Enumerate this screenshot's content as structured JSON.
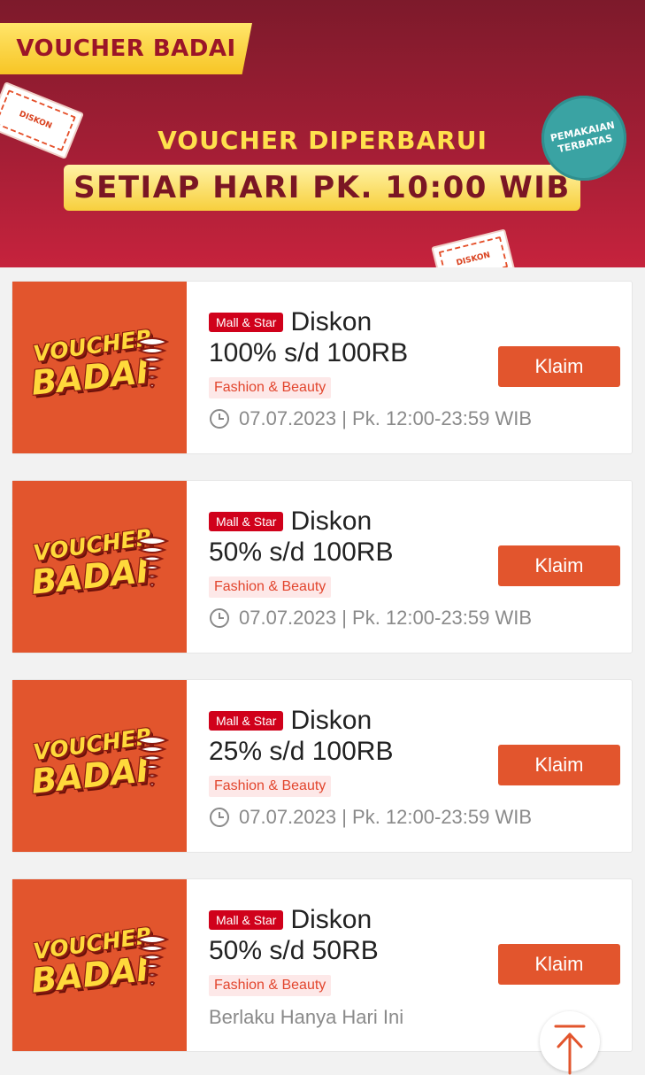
{
  "banner": {
    "tag": "VOUCHER BADAI",
    "headline_1": "VOUCHER DIPERBARUI",
    "headline_2": "SETIAP HARI PK. 10:00 WIB",
    "limit_badge_line1": "PEMAKAIAN",
    "limit_badge_line2": "TERBATAS",
    "deco_ticket_text": "DISKON"
  },
  "logo": {
    "line1": "VOUCHER",
    "line2": "BADAI"
  },
  "vouchers": [
    {
      "badge": "Mall & Star",
      "title": "Diskon",
      "amount": "100% s/d 100RB",
      "category": "Fashion & Beauty",
      "time": "07.07.2023 | Pk. 12:00-23:59 WIB",
      "claim": "Klaim"
    },
    {
      "badge": "Mall & Star",
      "title": "Diskon",
      "amount": "50% s/d 100RB",
      "category": "Fashion & Beauty",
      "time": "07.07.2023 | Pk. 12:00-23:59 WIB",
      "claim": "Klaim"
    },
    {
      "badge": "Mall & Star",
      "title": "Diskon",
      "amount": "25% s/d 100RB",
      "category": "Fashion & Beauty",
      "time": "07.07.2023 | Pk. 12:00-23:59 WIB",
      "claim": "Klaim"
    },
    {
      "badge": "Mall & Star",
      "title": "Diskon",
      "amount": "50% s/d 50RB",
      "category": "Fashion & Beauty",
      "note": "Berlaku Hanya Hari Ini",
      "claim": "Klaim"
    }
  ],
  "icons": {
    "clock": "clock-icon",
    "back_to_top": "arrow-up-icon",
    "tornado": "tornado-icon"
  },
  "colors": {
    "accent": "#e2552d",
    "badge_red": "#d0011b",
    "banner_yellow": "#ffe14d",
    "banner_red": "#a31e35",
    "teal": "#3aa3a3"
  }
}
